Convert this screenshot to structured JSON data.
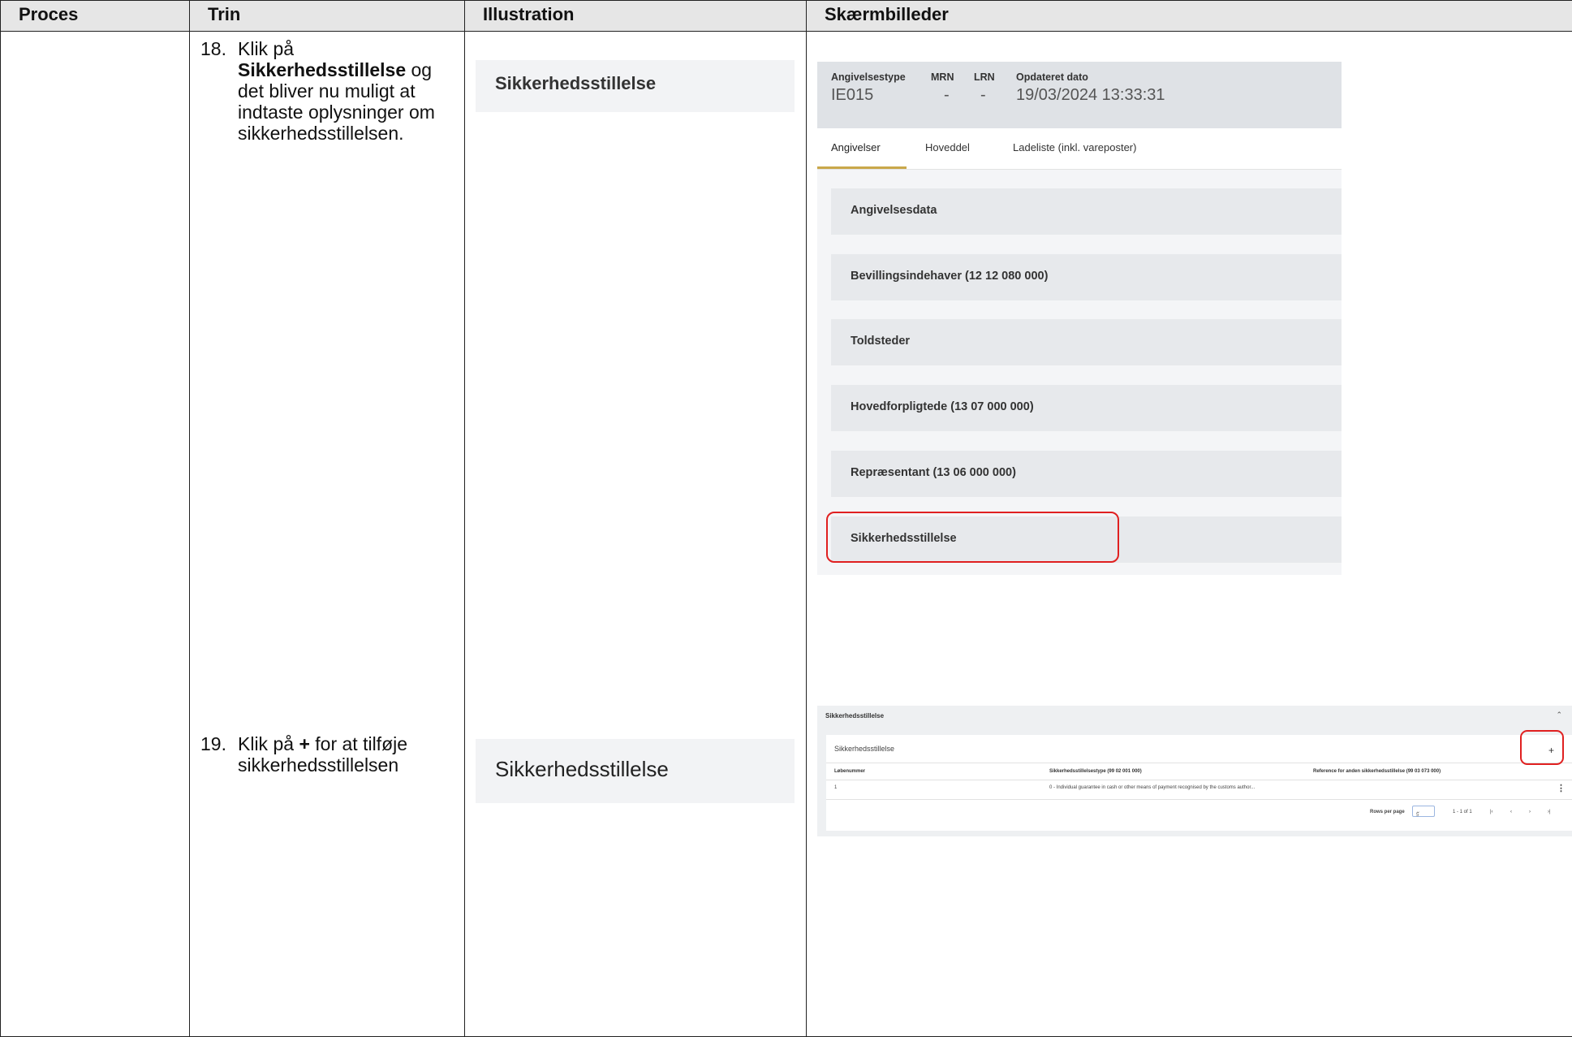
{
  "table": {
    "headers": [
      "Proces",
      "Trin",
      "Illustration",
      "Skærmbilleder"
    ]
  },
  "steps": [
    {
      "number": "18.",
      "text_before": "Klik på",
      "bold": "Sikkerhedsstillelse",
      "text_after": "og det bliver nu muligt at indtaste oplysninger om sikkerhedsstillelsen."
    },
    {
      "number": "19.",
      "text_before": "Klik på",
      "bold": "+",
      "text_after": "for at tilføje sikkerhedsstillelsen"
    }
  ],
  "illustrations": [
    "Sikkerhedsstillelse",
    "Sikkerhedsstillelse"
  ],
  "screenshot1": {
    "header": {
      "columns": [
        {
          "label": "Angivelsestype",
          "value": "IE015"
        },
        {
          "label": "MRN",
          "value": "-"
        },
        {
          "label": "LRN",
          "value": "-"
        },
        {
          "label": "Opdateret dato",
          "value": "19/03/2024 13:33:31"
        }
      ]
    },
    "tabs": [
      "Angivelser",
      "Hoveddel",
      "Ladeliste (inkl. vareposter)"
    ],
    "active_tab": "Angivelser",
    "sections": [
      "Angivelsesdata",
      "Bevillingsindehaver (12 12 080 000)",
      "Toldsteder",
      "Hovedforpligtede (13 07 000 000)",
      "Repræsentant (13 06 000 000)",
      "Sikkerhedsstillelse"
    ],
    "highlight_color": "#e02020"
  },
  "screenshot2": {
    "section_title": "Sikkerhedsstillelse",
    "panel_title": "Sikkerhedsstillelse",
    "add_label": "+",
    "collapse_icon": "chevron-up-icon",
    "columns": [
      "Løbenummer",
      "Sikkerhedsstillelsestype (99 02 001 000)",
      "Reference for anden sikkerhedsstillelse (99 03 073 000)"
    ],
    "rows": [
      {
        "number": "1",
        "type": "0 - Individual guarantee in cash or other means of payment recognised by the customs author...",
        "reference": ""
      }
    ],
    "footer": {
      "rows_per_page_label": "Rows per page",
      "rows_per_page_value": "5",
      "range": "1 - 1 of 1"
    }
  }
}
